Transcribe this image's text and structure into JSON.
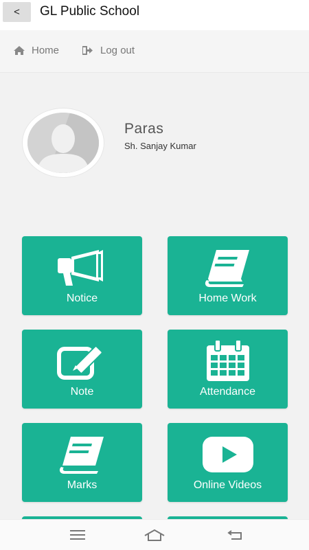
{
  "header": {
    "back_label": "<",
    "title": "GL Public School"
  },
  "nav": {
    "home_label": "Home",
    "logout_label": "Log out"
  },
  "profile": {
    "name": "Paras",
    "parent": "Sh. Sanjay Kumar"
  },
  "tiles": [
    {
      "label": "Notice",
      "icon": "megaphone-icon"
    },
    {
      "label": "Home Work",
      "icon": "book-icon"
    },
    {
      "label": "Note",
      "icon": "edit-note-icon"
    },
    {
      "label": "Attendance",
      "icon": "calendar-icon"
    },
    {
      "label": "Marks",
      "icon": "book-icon"
    },
    {
      "label": "Online Videos",
      "icon": "youtube-play-icon"
    }
  ],
  "colors": {
    "tile": "#1ab394",
    "background": "#f2f2f2"
  },
  "system_nav": [
    "menu-icon",
    "home-icon",
    "back-icon"
  ]
}
